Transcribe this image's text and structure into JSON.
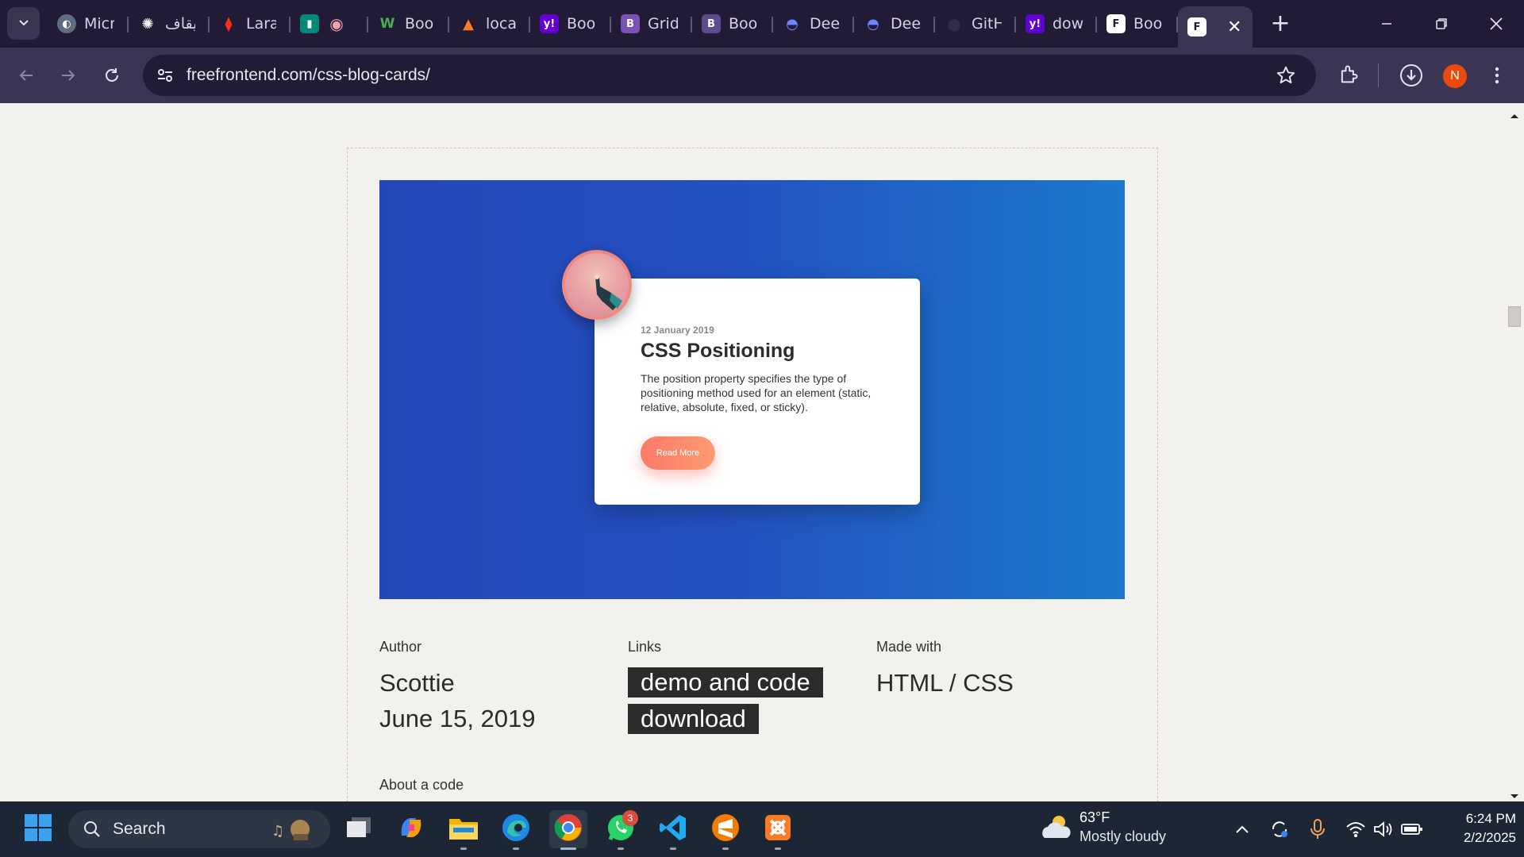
{
  "browser": {
    "tabs": [
      {
        "label": "Micr",
        "icon": "globe-icon",
        "color": "#5f6d7e"
      },
      {
        "label": "إيقاف",
        "icon": "chatgpt-icon",
        "color": "#221b35"
      },
      {
        "label": "Lara",
        "icon": "laravel-icon",
        "color": "#ff2d20"
      },
      {
        "label": "",
        "icon": "meet-icon",
        "color": "#00897b"
      },
      {
        "label": "Boo",
        "icon": "w-logo-icon",
        "color": "#2e7d32"
      },
      {
        "label": "loca",
        "icon": "xampp-icon",
        "color": "#fb7a24"
      },
      {
        "label": "Boo",
        "icon": "yahoo-icon",
        "color": "#6001d2"
      },
      {
        "label": "Grid",
        "icon": "bootstrap-icon",
        "color": "#7952b3"
      },
      {
        "label": "Boo",
        "icon": "bootstrap-icon",
        "color": "#5f4b8b"
      },
      {
        "label": "Dee",
        "icon": "deepseek-icon",
        "color": "#4d6bfe"
      },
      {
        "label": "Dee",
        "icon": "deepseek-icon",
        "color": "#4d6bfe"
      },
      {
        "label": "GitH",
        "icon": "github-icon",
        "color": "#24292f"
      },
      {
        "label": "dow",
        "icon": "yahoo-icon",
        "color": "#6001d2"
      },
      {
        "label": "Boo",
        "icon": "freefrontend-icon",
        "color": "#ffffff"
      }
    ],
    "active_tab_icon": "freefrontend-icon",
    "url": "freefrontend.com/css-blog-cards/",
    "profile_initial": "N",
    "accent_color": "#3b3452",
    "profile_color": "#ea4b0c"
  },
  "preview": {
    "date": "12 January 2019",
    "title": "CSS Positioning",
    "text": "The position property specifies the type of positioning method used for an element (static, relative, absolute, fixed, or sticky).",
    "button": "Read More",
    "gradient_start": "#2447b8",
    "gradient_end": "#1b78cb",
    "button_color": "#fc7a69"
  },
  "meta": {
    "author_label": "Author",
    "author": "Scottie",
    "date": "June 15, 2019",
    "links_label": "Links",
    "link_demo": "demo and code",
    "link_download": "download",
    "made_label": "Made with",
    "made_value": "HTML / CSS",
    "about_label": "About a code"
  },
  "taskbar": {
    "search_label": "Search",
    "weather_temp": "63°F",
    "weather_desc": "Mostly cloudy",
    "time": "6:24 PM",
    "date": "2/2/2025",
    "whatsapp_badge": "3"
  }
}
